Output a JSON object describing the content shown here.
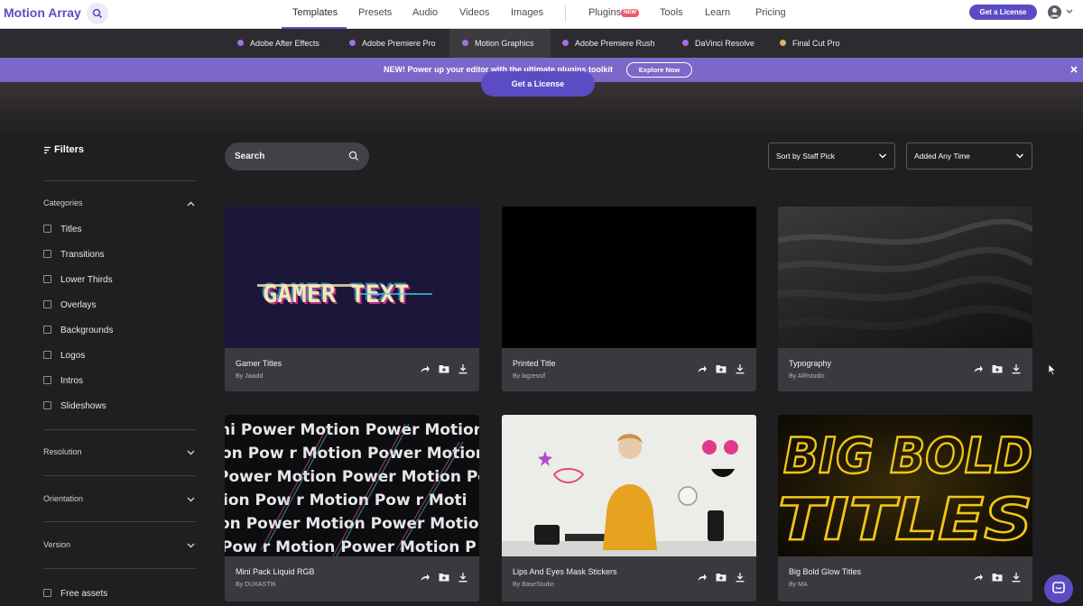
{
  "topnav": {
    "logo": "Motion Array",
    "links": [
      "Templates",
      "Presets",
      "Audio",
      "Videos",
      "Images",
      "Plugins",
      "Tools",
      "Learn",
      "Pricing"
    ],
    "new_badge": "NEW",
    "license_button": "Get a License"
  },
  "subnav": {
    "items": [
      {
        "label": "Adobe After Effects",
        "color": "#a66de0"
      },
      {
        "label": "Adobe Premiere Pro",
        "color": "#a66de0"
      },
      {
        "label": "Motion Graphics",
        "color": "#a66de0"
      },
      {
        "label": "Adobe Premiere Rush",
        "color": "#a66de0"
      },
      {
        "label": "DaVinci Resolve",
        "color": "#a66de0"
      },
      {
        "label": "Final Cut Pro",
        "color": "#d9b26a"
      }
    ]
  },
  "banner": {
    "text": "NEW! Power up your editor with the ultimate plugins toolkit",
    "button": "Explore Now"
  },
  "hero": {
    "button": "Get a License"
  },
  "filters": {
    "title": "Filters",
    "categories_label": "Categories",
    "categories": [
      "Titles",
      "Transitions",
      "Lower Thirds",
      "Overlays",
      "Backgrounds",
      "Logos",
      "Intros",
      "Slideshows"
    ],
    "sections": [
      "Resolution",
      "Orientation",
      "Version"
    ],
    "free_assets": "Free assets"
  },
  "toolbar": {
    "search_placeholder": "Search",
    "sort": "Sort by Staff Pick",
    "time": "Added Any Time"
  },
  "cards": [
    {
      "title": "Gamer Titles",
      "author": "By Jwadd"
    },
    {
      "title": "Printed Title",
      "author": "By lagressif"
    },
    {
      "title": "Typography",
      "author": "By AiRstudio"
    },
    {
      "title": "Mini Pack Liquid RGB",
      "author": "By DUXASTIK"
    },
    {
      "title": "Lips And Eyes Mask Stickers",
      "author": "By BaseStudio"
    },
    {
      "title": "Big Bold Glow Titles",
      "author": "By MA"
    }
  ],
  "thumb_text": {
    "gamer": "GAMER TEXT",
    "bigbold_1": "BIG BOLD",
    "bigbold_2": "TITLES",
    "liquid_rows": [
      "ni Power Motion Power Motion",
      "on Pow r Motion Power Motion",
      "Power Motion Power Motion Po",
      "ion Pow  r Motion Pow r Moti",
      "on Power Motion Power Motion",
      "Pow r Motion Power Motion P"
    ]
  },
  "colors": {
    "accent": "#5b4cc4",
    "banner": "#7b68c8",
    "surface": "#3a3a3e"
  }
}
